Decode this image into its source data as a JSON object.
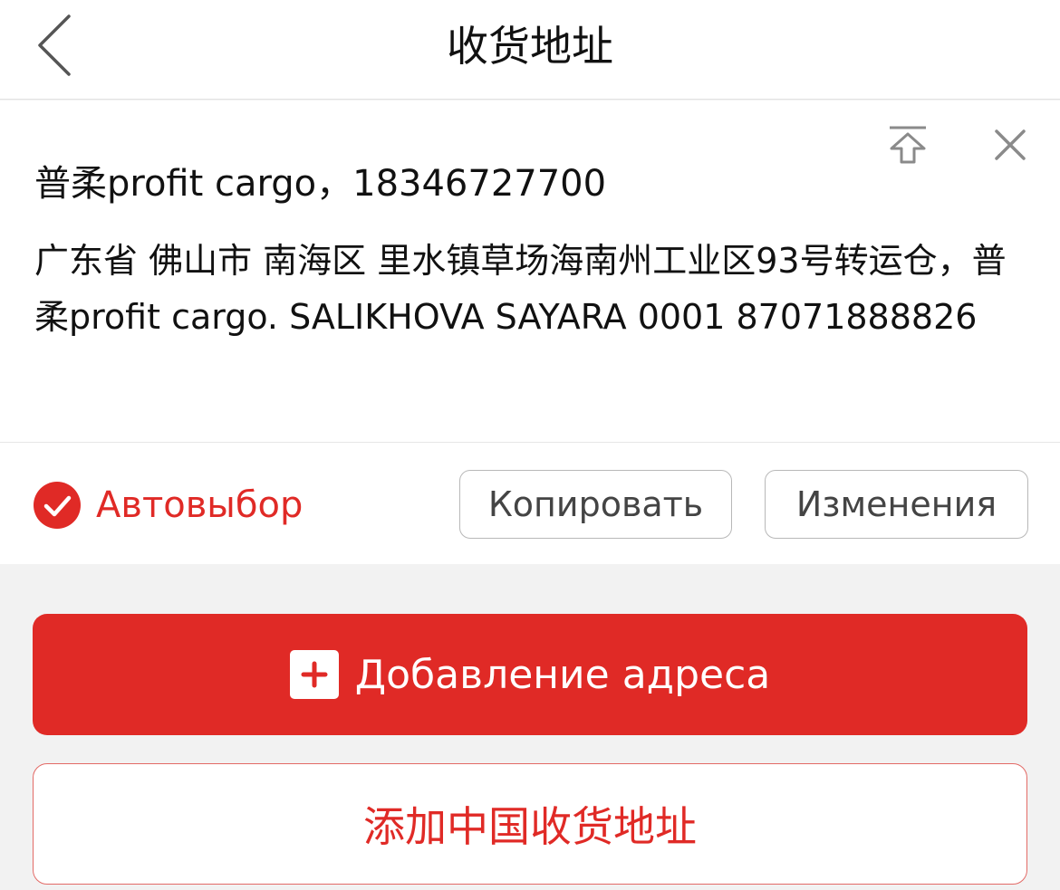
{
  "header": {
    "title": "收货地址",
    "back_icon": "chevron-left-icon"
  },
  "address_card": {
    "contact": "普柔profit cargo，18346727700",
    "address": "广东省 佛山市 南海区 里水镇草场海南州工业区93号转运仓，普柔profit cargo. SALIKHOVA SAYARA 0001 87071888826",
    "pin_icon": "pin-top-icon",
    "close_icon": "close-icon",
    "auto_select_label": "Автовыбор",
    "copy_label": "Копировать",
    "edit_label": "Изменения"
  },
  "actions": {
    "add_address_label": "Добавление адреса",
    "add_china_address_label": "添加中国收货地址"
  },
  "colors": {
    "accent": "#e02a26",
    "background": "#f2f2f2"
  }
}
